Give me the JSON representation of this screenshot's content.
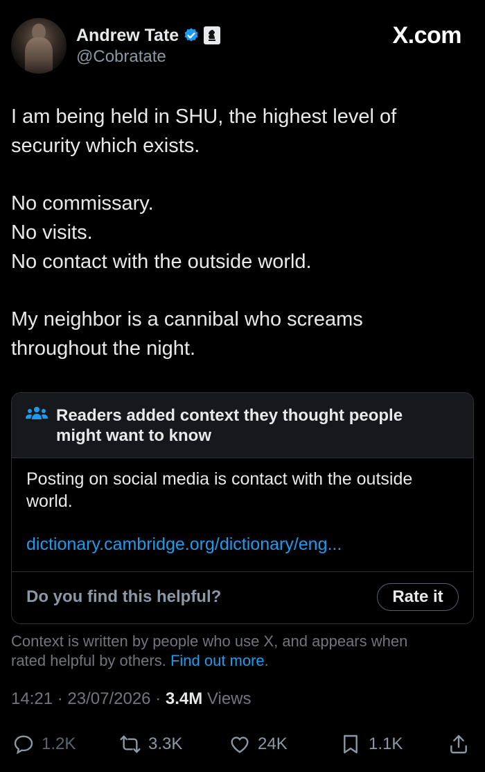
{
  "header": {
    "name": "Andrew Tate",
    "handle": "@Cobratate",
    "site": "X.com"
  },
  "tweet": {
    "line1": "I am being held in SHU, the highest level of",
    "line2": "security which exists.",
    "line3": "No commissary.",
    "line4": "No visits.",
    "line5": "No contact with the outside world.",
    "line6": "My neighbor is a cannibal who screams",
    "line7": "throughout the night."
  },
  "note": {
    "title_line1": "Readers added context they thought people",
    "title_line2": "might want to know",
    "body_line1": "Posting on social media is contact with the outside",
    "body_line2": "world.",
    "link": "dictionary.cambridge.org/dictionary/eng...",
    "question": "Do you find this helpful?",
    "rate_label": "Rate it"
  },
  "context": {
    "text1": "Context is written by people who use X, and appears when",
    "text2": "rated helpful by others.",
    "link": "Find out more",
    "end": "."
  },
  "meta": {
    "time": "14:21",
    "date": "23/07/2026",
    "views_count": "3.4M",
    "views_label": "Views"
  },
  "actions": {
    "replies": "1.2K",
    "reposts": "3.3K",
    "likes": "24K",
    "bookmarks": "1.1K"
  },
  "colors": {
    "background": "#000000",
    "text": "#e7e9ea",
    "muted": "#71767b",
    "accent": "#1d9bf0"
  }
}
